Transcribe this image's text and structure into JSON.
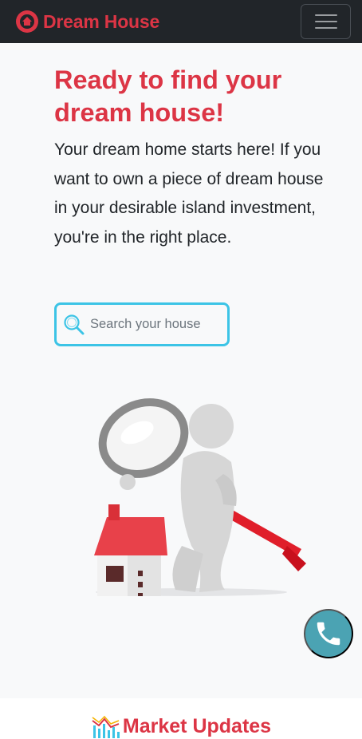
{
  "navbar": {
    "brand_text": "Dream House",
    "brand_icon": "brand-logo-icon",
    "menu_icon": "hamburger-menu-icon"
  },
  "hero": {
    "title": "Ready to find your dream house!",
    "description": "Your dream home starts here! If you want to own a piece of dream house in your desirable island investment, you're in the right place.",
    "search": {
      "placeholder": "Search your house",
      "value": ""
    },
    "illustration_icon": "magnifier-person-house-illustration"
  },
  "floating": {
    "call_icon": "phone-icon"
  },
  "market": {
    "title": "Market Updates",
    "icon": "chart-icon"
  },
  "colors": {
    "brand": "#dc3545",
    "navbar": "#212529",
    "hero_bg": "#f8f9fa",
    "search_border": "#3cc4e6",
    "call_button": "#4ba3b3"
  }
}
